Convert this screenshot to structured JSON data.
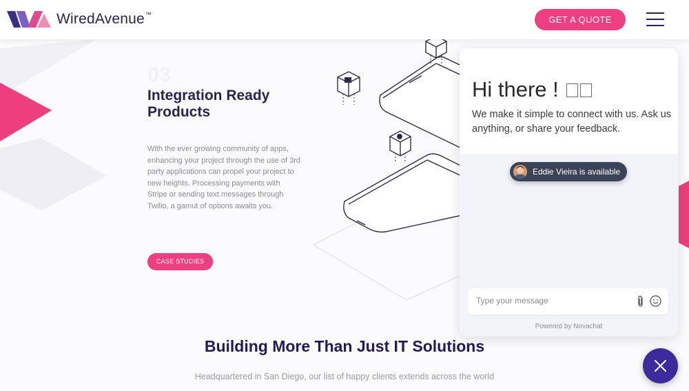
{
  "header": {
    "brand": "WiredAvenue",
    "trademark": "™",
    "cta_label": "GET A QUOTE"
  },
  "section": {
    "number": "03",
    "title": "Integration Ready Products",
    "description": "With the ever growing community of apps, enhancing your project through the use of 3rd party applications can propel your project to new heights. Processing payments with Stripe or sending text messages through Twilio, a gamut of options awaits you.",
    "button_label": "CASE STUDIES"
  },
  "footer_section": {
    "title": "Building More Than Just IT Solutions",
    "subtitle": "Headquartered in San Diego, our list of happy clients extends across the world"
  },
  "chat": {
    "greeting": "Hi there !",
    "intro": "We make it simple to connect with us. Ask us anything, or share your feedback.",
    "agent_status": "Eddie Vieira is available",
    "input_placeholder": "Type your message",
    "powered_by": "Powered by Novachat"
  },
  "colors": {
    "brand_pink": "#ee3f7f",
    "navy": "#2a2250",
    "fab_purple": "#3d2b9e"
  }
}
